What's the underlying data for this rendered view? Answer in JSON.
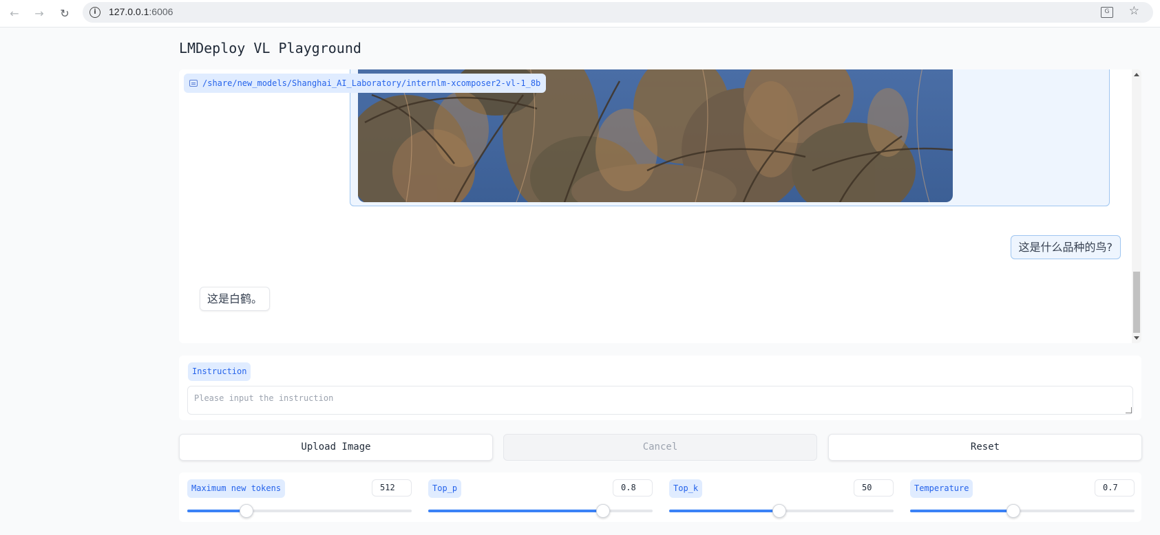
{
  "browser": {
    "url_host": "127.0.0.1",
    "url_port": ":6006"
  },
  "app": {
    "title": "LMDeploy VL Playground"
  },
  "chat": {
    "model_path": "/share/new_models/Shanghai_AI_Laboratory/internlm-xcomposer2-vl-1_8b",
    "messages": [
      {
        "role": "user",
        "type": "image"
      },
      {
        "role": "user",
        "type": "text",
        "text": "这是什么品种的鸟?"
      },
      {
        "role": "bot",
        "type": "text",
        "text": "这是白鹤。"
      }
    ]
  },
  "instruction": {
    "label": "Instruction",
    "placeholder": "Please input the instruction",
    "value": ""
  },
  "buttons": {
    "upload": "Upload Image",
    "cancel": "Cancel",
    "reset": "Reset"
  },
  "params": [
    {
      "label": "Maximum new tokens",
      "value": "512",
      "fraction": 0.265
    },
    {
      "label": "Top_p",
      "value": "0.8",
      "fraction": 0.78
    },
    {
      "label": "Top_k",
      "value": "50",
      "fraction": 0.49
    },
    {
      "label": "Temperature",
      "value": "0.7",
      "fraction": 0.46
    }
  ],
  "colors": {
    "accent": "#3b82f6",
    "label_bg": "#e0ecff",
    "label_text": "#2563eb",
    "user_bubble_bg": "#eef5fe",
    "user_bubble_border": "#9ec5f0"
  }
}
